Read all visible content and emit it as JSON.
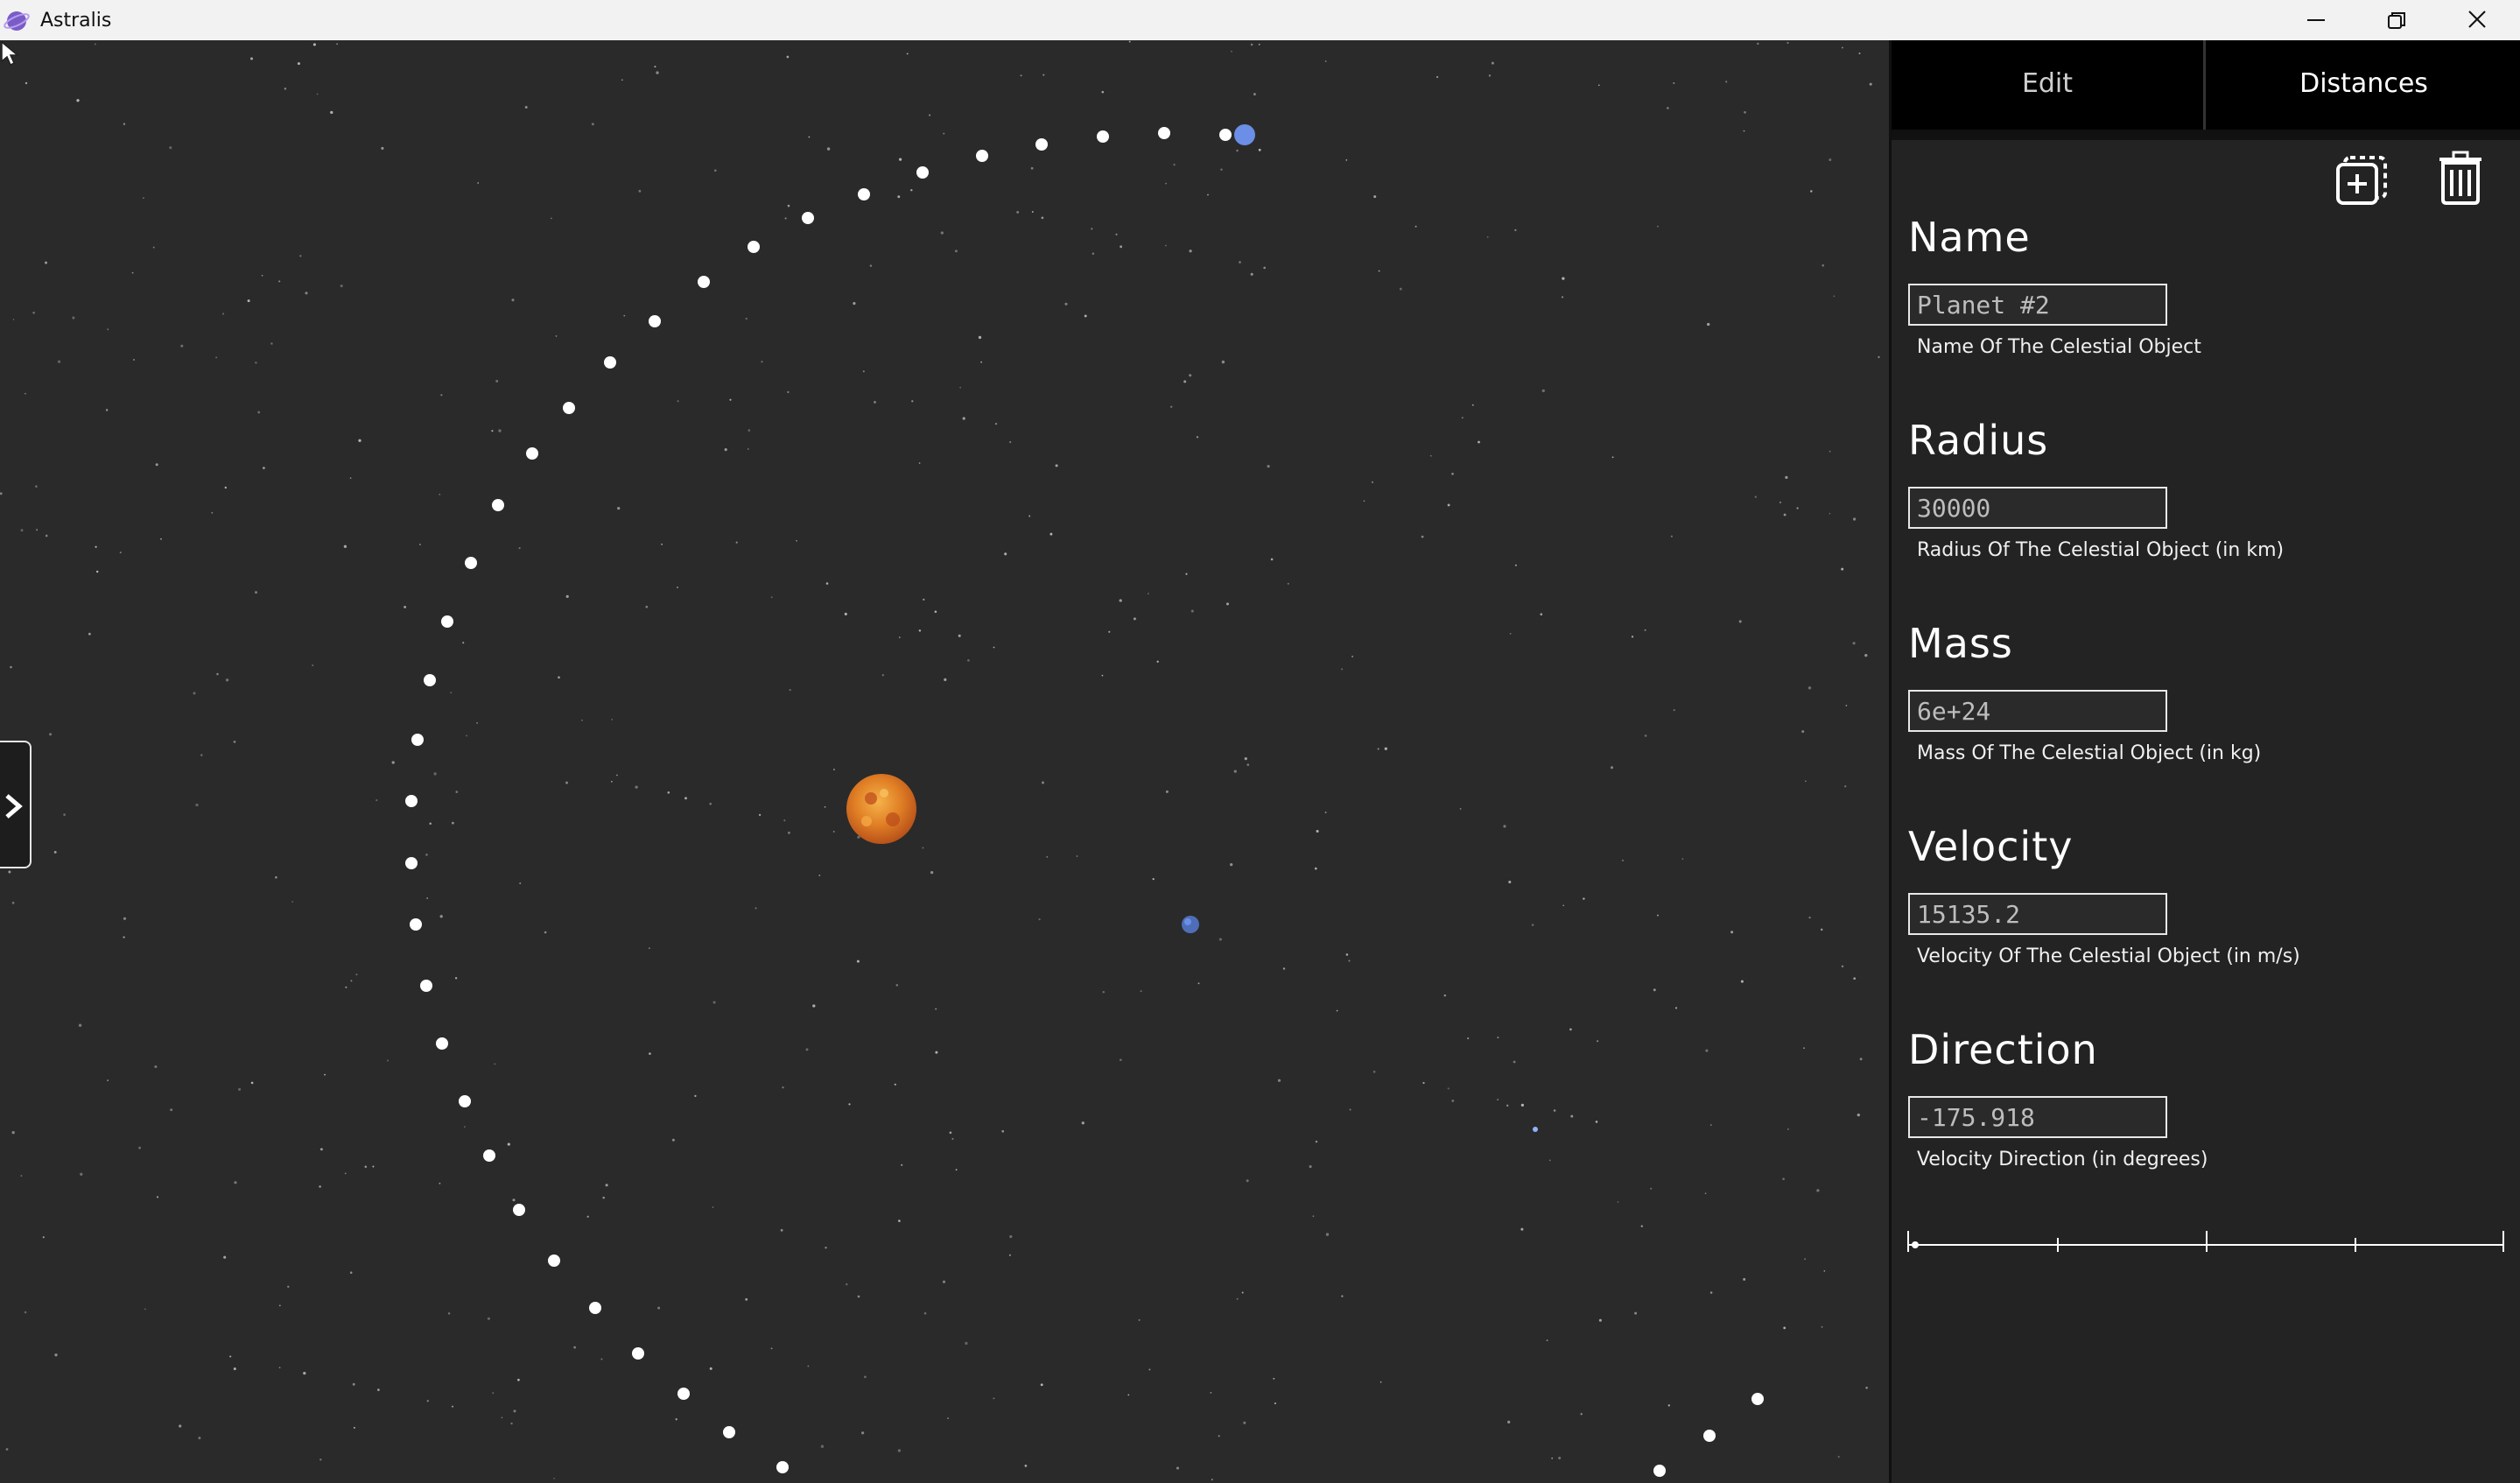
{
  "window": {
    "title": "Astralis",
    "icon": "planet-logo-icon",
    "controls": [
      "minimize-icon",
      "restore-icon",
      "close-icon"
    ]
  },
  "colors": {
    "space_bg": "#2a2a2a",
    "panel_bg": "#232323",
    "tab_bg": "#000000",
    "orbit_dot": "#ffffff",
    "planet_blue": "#6b8ee6",
    "sun_orange": "#e8892b"
  },
  "tabs": [
    {
      "label": "Edit"
    },
    {
      "label": "Distances"
    }
  ],
  "toolbar": {
    "duplicate_icon": "duplicate-add-icon",
    "delete_icon": "trash-icon"
  },
  "fields": {
    "name": {
      "label": "Name",
      "value": "Planet #2",
      "help": "Name Of The Celestial Object"
    },
    "radius": {
      "label": "Radius",
      "value": "30000",
      "help": "Radius Of The Celestial Object (in km)"
    },
    "mass": {
      "label": "Mass",
      "value": "6e+24",
      "help": "Mass Of The Celestial Object (in kg)"
    },
    "velocity": {
      "label": "Velocity",
      "value": "15135.2",
      "help": "Velocity Of The Celestial Object (in m/s)"
    },
    "direction": {
      "label": "Direction",
      "value": "-175.918",
      "help": "Velocity Direction (in degrees)"
    }
  },
  "sidebar_toggle_icon": "chevron-right-icon"
}
